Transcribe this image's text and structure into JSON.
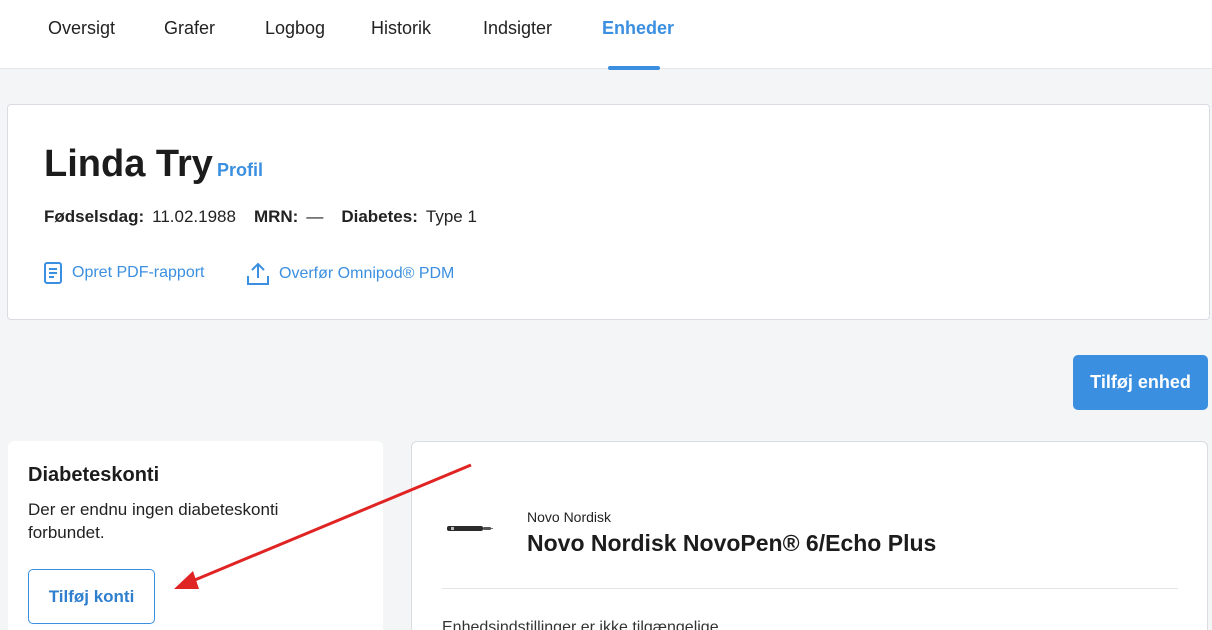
{
  "nav": {
    "tabs": [
      {
        "label": "Oversigt"
      },
      {
        "label": "Grafer"
      },
      {
        "label": "Logbog"
      },
      {
        "label": "Historik"
      },
      {
        "label": "Indsigter"
      },
      {
        "label": "Enheder"
      }
    ],
    "active_tab": "Enheder"
  },
  "patient": {
    "name": "Linda Try",
    "profile_link": "Profil",
    "birthday_label": "Fødselsdag:",
    "birthday_value": "11.02.1988",
    "mrn_label": "MRN:",
    "mrn_value": "—",
    "diabetes_label": "Diabetes:",
    "diabetes_value": "Type 1",
    "actions": {
      "pdf_report": "Opret PDF-rapport",
      "transfer_pdm": "Overfør Omnipod® PDM"
    }
  },
  "toolbar": {
    "add_device_label": "Tilføj enhed"
  },
  "accounts": {
    "title": "Diabeteskonti",
    "empty_text": "Der er endnu ingen diabeteskonti forbundet.",
    "add_button_label": "Tilføj konti"
  },
  "device": {
    "manufacturer": "Novo Nordisk",
    "name": "Novo Nordisk NovoPen® 6/Echo Plus",
    "settings_note": "Enhedsindstillinger er ikke tilgængelige"
  },
  "colors": {
    "accent": "#3b8fe0",
    "annotation_arrow": "#e02424"
  },
  "icons": {
    "pdf_report": "document-icon",
    "transfer_pdm": "upload-icon",
    "device": "insulin-pen-icon",
    "annotation": "red-arrow-annotation"
  }
}
